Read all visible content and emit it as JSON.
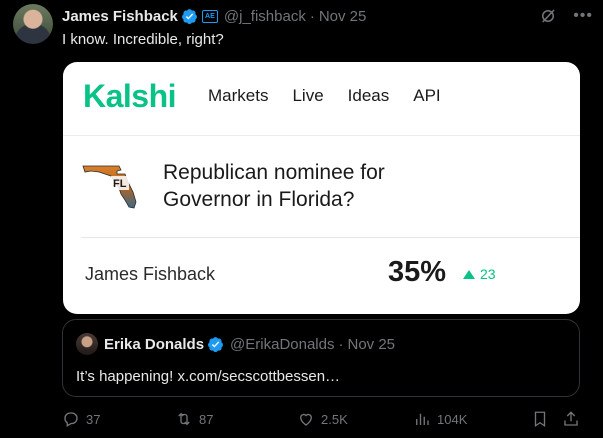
{
  "tweet": {
    "author_name": "James Fishback",
    "handle": "@j_fishback",
    "separator": "·",
    "date": "Nov 25",
    "org_badge": "AE",
    "text": "I know. Incredible, right?"
  },
  "card": {
    "logo": "Kalshi",
    "nav": [
      "Markets",
      "Live",
      "Ideas",
      "API"
    ],
    "state_label": "FL",
    "market_title": "Republican nominee for Governor in Florida?",
    "candidate": "James Fishback",
    "probability": "35%",
    "change": "23",
    "colors": {
      "brand": "#09c285"
    }
  },
  "quote": {
    "author_name": "Erika Donalds",
    "handle": "@ErikaDonalds",
    "separator": "·",
    "date": "Nov 25",
    "text": "It’s happening! x.com/secscottbessen…"
  },
  "actions": {
    "replies": "37",
    "reposts": "87",
    "likes": "2.5K",
    "views": "104K"
  },
  "icons": [
    "verified-icon",
    "grok-icon",
    "more-icon",
    "reply-icon",
    "repost-icon",
    "like-icon",
    "views-icon",
    "bookmark-icon",
    "share-icon"
  ]
}
